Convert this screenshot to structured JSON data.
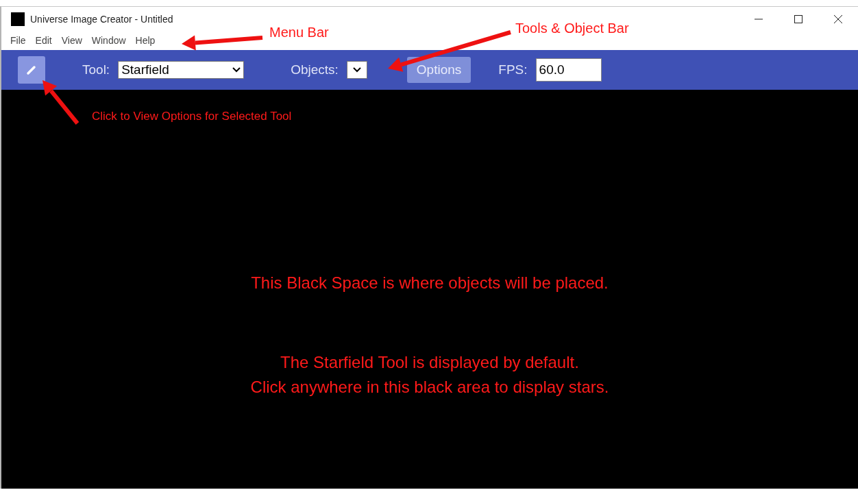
{
  "window": {
    "title": "Universe Image Creator - Untitled"
  },
  "menu": [
    "File",
    "Edit",
    "View",
    "Window",
    "Help"
  ],
  "toolbar": {
    "tool_label": "Tool:",
    "tool_value": "Starfield",
    "objects_label": "Objects:",
    "options_button": "Options",
    "fps_label": "FPS:",
    "fps_value": "60.0"
  },
  "callouts": [
    {
      "text": "Menu Bar"
    },
    {
      "text": "Tools & Object Bar"
    },
    {
      "text": "Click to View Options for Selected Tool"
    }
  ],
  "canvas_notes": [
    [
      "This Black Space is where objects will be placed."
    ],
    [
      "The Starfield Tool is displayed by default.",
      "Click anywhere in this black area to display stars."
    ]
  ]
}
